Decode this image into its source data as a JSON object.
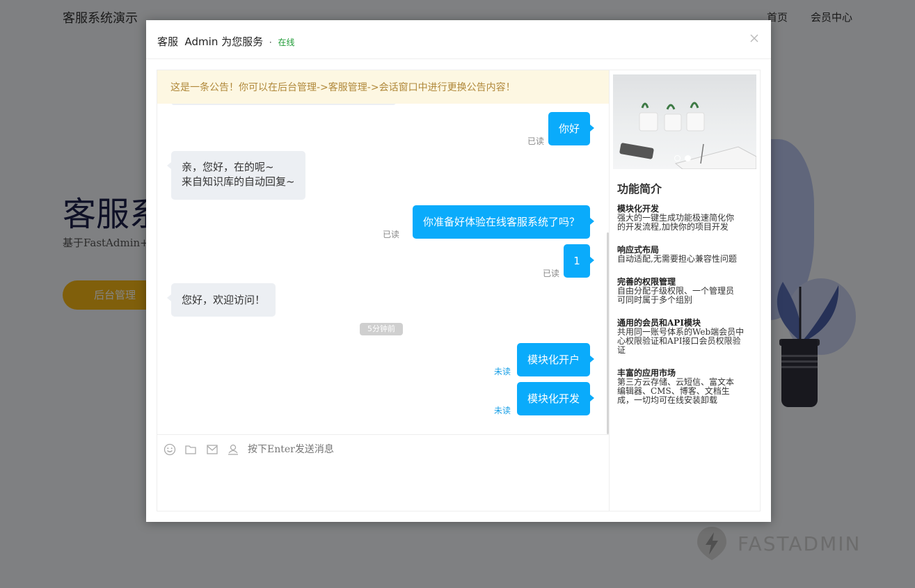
{
  "background": {
    "site_title": "客服系统演示",
    "nav": {
      "home": "首页",
      "member": "会员中心"
    },
    "hero_title": "客服系统",
    "hero_subtitle": "基于FastAdmin+Workerman",
    "hero_button": "后台管理",
    "brand": "FASTADMIN"
  },
  "modal": {
    "title": "客服  Admin 为您服务",
    "separator": "·",
    "status": "在线",
    "close_icon": "close-icon"
  },
  "chat": {
    "notice": "这是一条公告！你可以在后台管理->客服管理->会话窗口中进行更换公告内容！",
    "messages": [
      {
        "direction": "out",
        "text": "你好",
        "status": "已读"
      },
      {
        "direction": "in",
        "lines": [
          "亲，您好，在的呢~",
          "来自知识库的自动回复~"
        ]
      },
      {
        "direction": "out",
        "text": "你准备好体验在线客服系统了吗？",
        "status": "已读"
      },
      {
        "direction": "out",
        "text": "1",
        "status": "已读"
      },
      {
        "direction": "in",
        "text": "您好，欢迎访问！"
      },
      {
        "direction": "out",
        "text": "模块化开户",
        "status": "未读"
      },
      {
        "direction": "out",
        "text": "模块化开发",
        "status": "未读"
      }
    ],
    "time_divider": "5分钟前",
    "toolbar_icons": [
      "emoji-icon",
      "folder-icon",
      "mail-icon",
      "user-icon"
    ],
    "input_placeholder": "按下Enter发送消息"
  },
  "sidebar": {
    "title": "功能简介",
    "features": [
      {
        "title": "模块化开发",
        "desc": [
          "强大的一键生成功能极速简化你",
          "的开发流程,加快你的项目开发"
        ]
      },
      {
        "title": "响应式布局",
        "desc": [
          "自动适配,无需要担心兼容性问题"
        ]
      },
      {
        "title": "完善的权限管理",
        "desc": [
          "自由分配子级权限、一个管理员",
          "可同时属于多个组别"
        ]
      },
      {
        "title": "通用的会员和API模块",
        "desc": [
          "共用同一账号体系的Web端会员中",
          "心权限验证和API接口会员权限验",
          "证"
        ]
      },
      {
        "title": "丰富的应用市场",
        "desc": [
          "第三方云存储、云短信、富文本",
          "编辑器、CMS、博客、文档生",
          "成，一切均可在线安装卸载"
        ]
      }
    ]
  },
  "colors": {
    "accent": "#0aabfb",
    "online": "#1e9a35",
    "notice_bg": "#fdf7e2",
    "notice_text": "#b0883a",
    "unread": "#1aa0e6"
  }
}
